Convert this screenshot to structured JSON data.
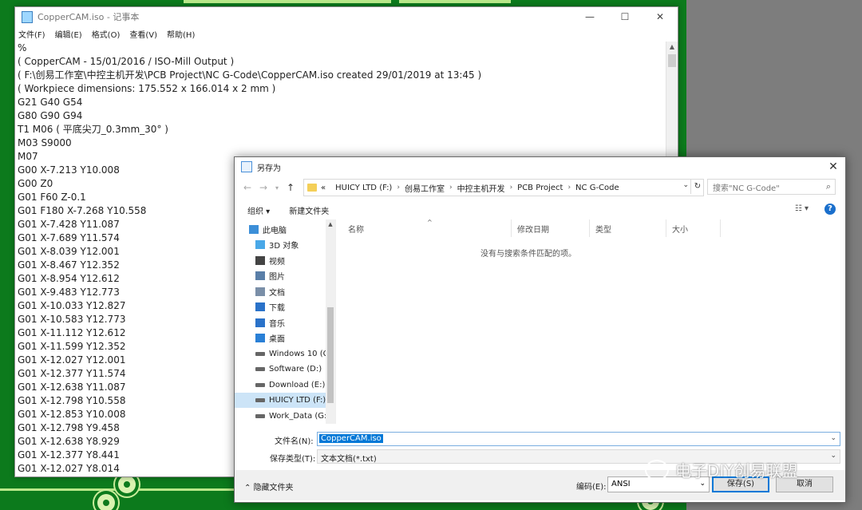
{
  "notepad": {
    "title": "CopperCAM.iso - 记事本",
    "menu": [
      "文件(F)",
      "编辑(E)",
      "格式(O)",
      "查看(V)",
      "帮助(H)"
    ],
    "lines": [
      "%",
      "( CopperCAM - 15/01/2016 / ISO-Mill Output )",
      "( F:\\创易工作室\\中控主机开发\\PCB Project\\NC G-Code\\CopperCAM.iso created 29/01/2019 at 13:45 )",
      "( Workpiece dimensions: 175.552 x 166.014 x 2 mm )",
      "G21 G40 G54",
      "G80 G90 G94",
      "T1 M06 ( 平底尖刀_0.3mm_30° )",
      "M03 S9000",
      "M07",
      "G00 X-7.213 Y10.008",
      "G00 Z0",
      "G01 F60 Z-0.1",
      "G01 F180 X-7.268 Y10.558",
      "G01 X-7.428 Y11.087",
      "G01 X-7.689 Y11.574",
      "G01 X-8.039 Y12.001",
      "G01 X-8.467 Y12.352",
      "G01 X-8.954 Y12.612",
      "G01 X-9.483 Y12.773",
      "G01 X-10.033 Y12.827",
      "G01 X-10.583 Y12.773",
      "G01 X-11.112 Y12.612",
      "G01 X-11.599 Y12.352",
      "G01 X-12.027 Y12.001",
      "G01 X-12.377 Y11.574",
      "G01 X-12.638 Y11.087",
      "G01 X-12.798 Y10.558",
      "G01 X-12.853 Y10.008",
      "G01 X-12.798 Y9.458",
      "G01 X-12.638 Y8.929",
      "G01 X-12.377 Y8.441",
      "G01 X-12.027 Y8.014"
    ]
  },
  "dialog": {
    "title": "另存为",
    "breadcrumb": [
      "«",
      "HUICY LTD (F:)",
      "创易工作室",
      "中控主机开发",
      "PCB Project",
      "NC G-Code"
    ],
    "search_placeholder": "搜索\"NC G-Code\"",
    "toolbar": {
      "organize": "组织 ▾",
      "new_folder": "新建文件夹"
    },
    "nav_items": [
      {
        "label": "此电脑",
        "icon": "computer-icon"
      },
      {
        "label": "3D 对象",
        "icon": "3d-objects-icon"
      },
      {
        "label": "视频",
        "icon": "video-icon"
      },
      {
        "label": "图片",
        "icon": "pictures-icon"
      },
      {
        "label": "文档",
        "icon": "documents-icon"
      },
      {
        "label": "下载",
        "icon": "download-icon"
      },
      {
        "label": "音乐",
        "icon": "music-icon"
      },
      {
        "label": "桌面",
        "icon": "desktop-icon"
      },
      {
        "label": "Windows 10 (C",
        "icon": "drive-icon"
      },
      {
        "label": "Software (D:)",
        "icon": "drive-icon"
      },
      {
        "label": "Download (E:)",
        "icon": "drive-icon"
      },
      {
        "label": "HUICY LTD (F:)",
        "icon": "drive-icon"
      },
      {
        "label": "Work_Data (G:",
        "icon": "drive-icon"
      }
    ],
    "selected_nav_index": 11,
    "columns": [
      "名称",
      "修改日期",
      "类型",
      "大小"
    ],
    "empty_message": "没有与搜索条件匹配的项。",
    "filename_label": "文件名(N):",
    "filename_value": "CopperCAM.iso",
    "filetype_label": "保存类型(T):",
    "filetype_value": "文本文档(*.txt)",
    "hide_folders": "隐藏文件夹",
    "encoding_label": "编码(E):",
    "encoding_value": "ANSI",
    "save_button": "保存(S)",
    "cancel_button": "取消"
  },
  "watermark": "电子DIY创易联盟",
  "colors": {
    "pcb_green": "#0c7a1c",
    "selection_blue": "#0078d7",
    "nav_selected": "#cce4f7"
  }
}
